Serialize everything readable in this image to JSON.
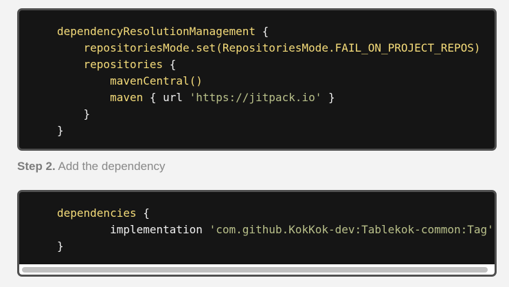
{
  "settings_block": {
    "lines": [
      {
        "indent": "",
        "parts": [
          {
            "t": "kw",
            "text": "dependencyResolutionManagement"
          },
          {
            "t": "plain",
            "text": " {"
          }
        ]
      },
      {
        "indent": "    ",
        "parts": [
          {
            "t": "kw",
            "text": "repositoriesMode.set(RepositoriesMode.FAIL_ON_PROJECT_REPOS)"
          }
        ]
      },
      {
        "indent": "    ",
        "parts": [
          {
            "t": "kw",
            "text": "repositories"
          },
          {
            "t": "plain",
            "text": " {"
          }
        ]
      },
      {
        "indent": "        ",
        "parts": [
          {
            "t": "kw",
            "text": "mavenCentral()"
          }
        ]
      },
      {
        "indent": "        ",
        "parts": [
          {
            "t": "kw",
            "text": "maven"
          },
          {
            "t": "plain",
            "text": " { url "
          },
          {
            "t": "str",
            "text": "'https://jitpack.io'"
          },
          {
            "t": "plain",
            "text": " }"
          }
        ]
      },
      {
        "indent": "    ",
        "parts": [
          {
            "t": "plain",
            "text": "}"
          }
        ]
      },
      {
        "indent": "",
        "parts": [
          {
            "t": "plain",
            "text": "}"
          }
        ]
      }
    ]
  },
  "step": {
    "number": "Step 2.",
    "text": " Add the dependency"
  },
  "dependency_block": {
    "lines": [
      {
        "indent": "",
        "parts": [
          {
            "t": "kw",
            "text": "dependencies"
          },
          {
            "t": "plain",
            "text": " {"
          }
        ]
      },
      {
        "indent": "        ",
        "parts": [
          {
            "t": "plain",
            "text": "implementation "
          },
          {
            "t": "str",
            "text": "'com.github.KokKok-dev:Tablekok-common:Tag'"
          }
        ]
      },
      {
        "indent": "",
        "parts": [
          {
            "t": "plain",
            "text": "}"
          }
        ]
      }
    ]
  }
}
